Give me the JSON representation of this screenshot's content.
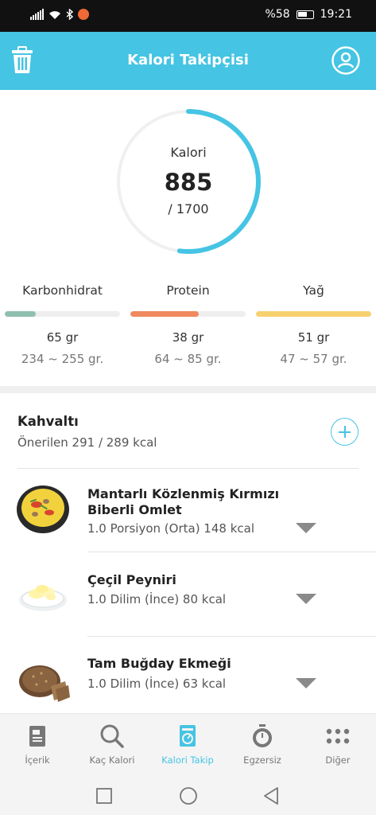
{
  "status_bar": {
    "battery": "%58",
    "time": "19:21"
  },
  "header": {
    "title": "Kalori Takipçisi"
  },
  "calories": {
    "label": "Kalori",
    "value": "885",
    "goal": "/ 1700",
    "progress": 0.52,
    "color": "#45c4e3"
  },
  "macros": [
    {
      "name": "Karbonhidrat",
      "amount": "65 gr",
      "range": "234 ~ 255 gr.",
      "progress": 0.27,
      "color": "#8fbfae"
    },
    {
      "name": "Protein",
      "amount": "38 gr",
      "range": "64 ~ 85 gr.",
      "progress": 0.59,
      "color": "#f0895e"
    },
    {
      "name": "Yağ",
      "amount": "51 gr",
      "range": "47 ~ 57 gr.",
      "progress": 1.0,
      "color": "#f7d070"
    }
  ],
  "meal": {
    "title": "Kahvaltı",
    "subtitle": "Önerilen 291 / 289 kcal",
    "items": [
      {
        "name": "Mantarlı Közlenmiş Kırmızı Biberli Omlet",
        "desc": "1.0 Porsiyon (Orta) 148 kcal"
      },
      {
        "name": "Çeçil Peyniri",
        "desc": "1.0 Dilim (İnce) 80 kcal"
      },
      {
        "name": "Tam Buğday Ekmeği",
        "desc": "1.0 Dilim (İnce) 63 kcal"
      }
    ]
  },
  "bottom_nav": [
    {
      "label": "İçerik",
      "icon": "book-icon"
    },
    {
      "label": "Kaç Kalori",
      "icon": "search-icon"
    },
    {
      "label": "Kalori Takip",
      "icon": "scale-icon",
      "active": true
    },
    {
      "label": "Egzersiz",
      "icon": "stopwatch-icon"
    },
    {
      "label": "Diğer",
      "icon": "more-dots-icon"
    }
  ]
}
